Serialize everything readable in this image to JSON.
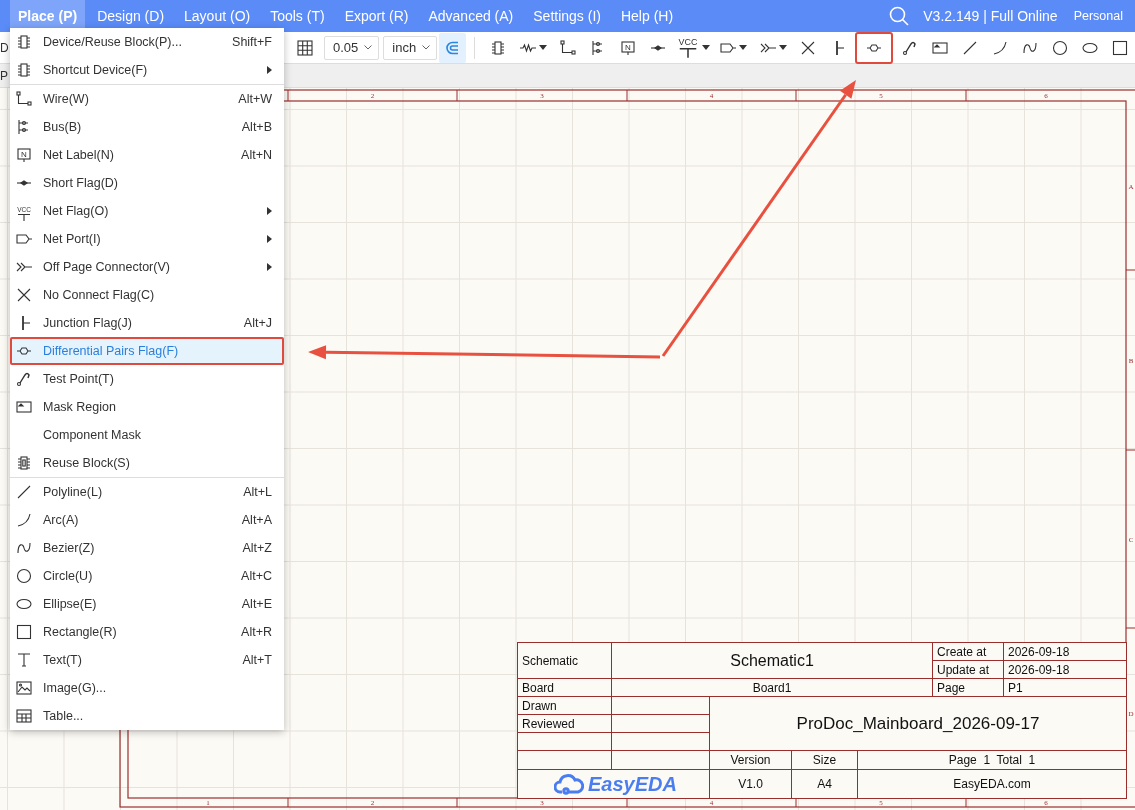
{
  "menubar": {
    "items": [
      {
        "label": "Place (P)",
        "selected": true
      },
      {
        "label": "Design (D)",
        "selected": false
      },
      {
        "label": "Layout (O)",
        "selected": false
      },
      {
        "label": "Tools (T)",
        "selected": false
      },
      {
        "label": "Export (R)",
        "selected": false
      },
      {
        "label": "Advanced (A)",
        "selected": false
      },
      {
        "label": "Settings (I)",
        "selected": false
      },
      {
        "label": "Help (H)",
        "selected": false
      }
    ],
    "version": "V3.2.149 | Full Online",
    "account": "Personal"
  },
  "toolbar": {
    "cut_label": "D",
    "grid_size": "0.05",
    "unit": "inch",
    "snap_on": true,
    "tools": [
      {
        "dropdown": false,
        "annotated": false
      },
      {
        "dropdown": true,
        "annotated": false
      },
      {
        "dropdown": false,
        "annotated": false
      },
      {
        "dropdown": false,
        "annotated": false
      },
      {
        "dropdown": false,
        "annotated": false,
        "badge": "N"
      },
      {
        "dropdown": false,
        "annotated": false
      },
      {
        "dropdown": true,
        "annotated": false,
        "badge": "VCC"
      },
      {
        "dropdown": true,
        "annotated": false
      },
      {
        "dropdown": true,
        "annotated": false
      },
      {
        "dropdown": false,
        "annotated": false
      },
      {
        "dropdown": false,
        "annotated": false
      },
      {
        "dropdown": false,
        "annotated": true
      },
      {
        "dropdown": false,
        "annotated": false
      },
      {
        "dropdown": false,
        "annotated": false
      },
      {
        "dropdown": false,
        "annotated": false
      },
      {
        "dropdown": false,
        "annotated": false
      },
      {
        "dropdown": false,
        "annotated": false
      },
      {
        "dropdown": false,
        "annotated": false
      },
      {
        "dropdown": false,
        "annotated": false
      },
      {
        "dropdown": false,
        "annotated": false
      }
    ]
  },
  "tab_strip": {
    "cut_label": "P"
  },
  "place_menu": {
    "groups": [
      [
        {
          "label": "Device/Reuse Block(P)...",
          "shortcut": "Shift+F",
          "submenu": false,
          "selected": false
        },
        {
          "label": "Shortcut Device(F)",
          "submenu": true,
          "selected": false
        }
      ],
      [
        {
          "label": "Wire(W)",
          "shortcut": "Alt+W",
          "submenu": false,
          "selected": false
        },
        {
          "label": "Bus(B)",
          "shortcut": "Alt+B",
          "submenu": false,
          "selected": false
        },
        {
          "label": "Net Label(N)",
          "shortcut": "Alt+N",
          "submenu": false,
          "selected": false,
          "badge": "N"
        },
        {
          "label": "Short Flag(D)",
          "submenu": false,
          "selected": false
        },
        {
          "label": "Net Flag(O)",
          "submenu": true,
          "selected": false,
          "badge": "VCC"
        },
        {
          "label": "Net Port(I)",
          "submenu": true,
          "selected": false
        },
        {
          "label": "Off Page Connector(V)",
          "submenu": true,
          "selected": false
        },
        {
          "label": "No Connect Flag(C)",
          "submenu": false,
          "selected": false
        },
        {
          "label": "Junction Flag(J)",
          "shortcut": "Alt+J",
          "submenu": false,
          "selected": false
        },
        {
          "label": "Differential Pairs Flag(F)",
          "submenu": false,
          "selected": true,
          "annotated": true
        },
        {
          "label": "Test Point(T)",
          "submenu": false,
          "selected": false
        },
        {
          "label": "Mask Region",
          "submenu": false,
          "selected": false
        },
        {
          "label": "Component Mask",
          "submenu": false,
          "selected": false
        },
        {
          "label": "Reuse Block(S)",
          "submenu": false,
          "selected": false
        }
      ],
      [
        {
          "label": "Polyline(L)",
          "shortcut": "Alt+L",
          "submenu": false,
          "selected": false
        },
        {
          "label": "Arc(A)",
          "shortcut": "Alt+A",
          "submenu": false,
          "selected": false
        },
        {
          "label": "Bezier(Z)",
          "shortcut": "Alt+Z",
          "submenu": false,
          "selected": false
        },
        {
          "label": "Circle(U)",
          "shortcut": "Alt+C",
          "submenu": false,
          "selected": false
        },
        {
          "label": "Ellipse(E)",
          "shortcut": "Alt+E",
          "submenu": false,
          "selected": false
        },
        {
          "label": "Rectangle(R)",
          "shortcut": "Alt+R",
          "submenu": false,
          "selected": false
        },
        {
          "label": "Text(T)",
          "shortcut": "Alt+T",
          "submenu": false,
          "selected": false
        },
        {
          "label": "Image(G)...",
          "submenu": false,
          "selected": false
        },
        {
          "label": "Table...",
          "submenu": false,
          "selected": false
        }
      ]
    ]
  },
  "sheet": {
    "top_labels": [
      "2",
      "3",
      "4",
      "5",
      "6"
    ],
    "bottom_labels": [
      "1",
      "2",
      "3",
      "4",
      "5",
      "6"
    ],
    "side_labels": [
      "A",
      "B",
      "C",
      "D"
    ],
    "title_block": {
      "schematic_label": "Schematic",
      "schematic": "Schematic1",
      "create_label": "Create at",
      "create_date": "2026-09-18",
      "update_label": "Update at",
      "update_date": "2026-09-18",
      "board_label": "Board",
      "board": "Board1",
      "page_label": "Page",
      "page": "P1",
      "drawn_label": "Drawn",
      "reviewed_label": "Reviewed",
      "title": "ProDoc_Mainboard_2026-09-17",
      "version_label": "Version",
      "size_label": "Size",
      "pages": "Page  1  Total  1",
      "logo_text": "EasyEDA",
      "version": "V1.0",
      "size": "A4",
      "website": "EasyEDA.com"
    }
  }
}
